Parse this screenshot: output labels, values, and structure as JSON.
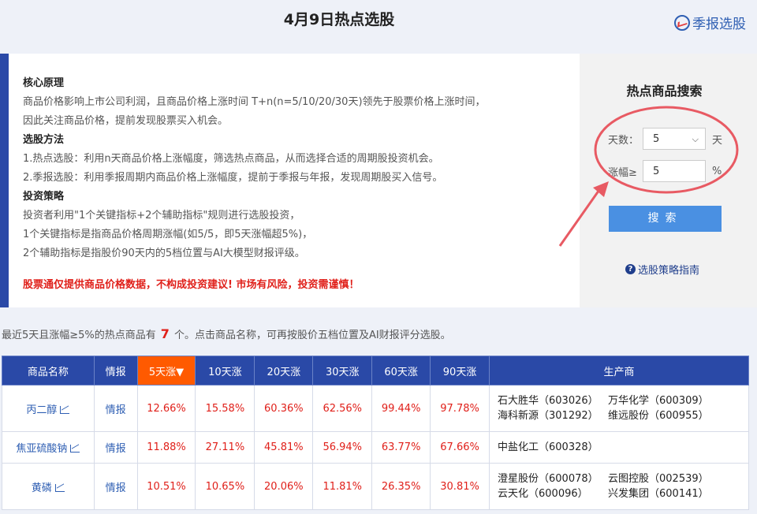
{
  "header": {
    "title": "4月9日热点选股",
    "link": "季报选股"
  },
  "intro": {
    "sections": [
      {
        "heading": "核心原理",
        "lines": [
          "商品价格影响上市公司利润，且商品价格上涨时间 T+n(n=5/10/20/30天)领先于股票价格上涨时间，",
          "因此关注商品价格，提前发现股票买入机会。"
        ]
      },
      {
        "heading": "选股方法",
        "lines": [
          "1.热点选股：利用n天商品价格上涨幅度，筛选热点商品，从而选择合适的周期股投资机会。",
          "2.季报选股：利用季报周期内商品价格上涨幅度，提前于季报与年报，发现周期股买入信号。"
        ]
      },
      {
        "heading": "投资策略",
        "lines": [
          "投资者利用\"1个关键指标+2个辅助指标\"规则进行选股投资，",
          "1个关键指标是指商品价格周期涨幅(如5/5，即5天涨幅超5%)，",
          "2个辅助指标是指股价90天内的5档位置与AI大模型财报评级。"
        ]
      }
    ],
    "warning": "股票通仅提供商品价格数据，不构成投资建议! 市场有风险，投资需谨慎！"
  },
  "search": {
    "title": "热点商品搜索",
    "days_label": "天数：",
    "days_value": "5",
    "days_unit": "天",
    "rise_label": "涨幅≥",
    "rise_value": "5",
    "rise_unit": "%",
    "button": "搜索",
    "guide": "选股策略指南",
    "annotation_color": "#e85a63"
  },
  "summary": {
    "prefix": "最近5天且涨幅≥5%的热点商品有",
    "count": "7",
    "suffix": "个。点击商品名称，可再按股价五档位置及AI财报评分选股。"
  },
  "table": {
    "headers": [
      "商品名称",
      "情报",
      "5天涨▼",
      "10天涨",
      "20天涨",
      "30天涨",
      "60天涨",
      "90天涨",
      "生产商"
    ],
    "rows": [
      {
        "name": "丙二醇",
        "info": "情报",
        "d5": "12.66%",
        "d10": "15.58%",
        "d20": "60.36%",
        "d30": "62.56%",
        "d60": "99.44%",
        "d90": "97.78%",
        "producers": [
          "石大胜华（603026）",
          "万华化学（600309）",
          "海科新源（301292）",
          "维远股份（600955）"
        ]
      },
      {
        "name": "焦亚硫酸钠",
        "info": "情报",
        "d5": "11.88%",
        "d10": "27.11%",
        "d20": "45.81%",
        "d30": "56.94%",
        "d60": "63.77%",
        "d90": "67.66%",
        "producers": [
          "中盐化工（600328）"
        ]
      },
      {
        "name": "黄磷",
        "info": "情报",
        "d5": "10.51%",
        "d10": "10.65%",
        "d20": "20.06%",
        "d30": "11.81%",
        "d60": "26.35%",
        "d90": "30.81%",
        "producers": [
          "澄星股份（600078）",
          "云图控股（002539）",
          "云天化（600096）",
          "兴发集团（600141）"
        ]
      }
    ]
  },
  "colors": {
    "header_blue": "#2a49a7",
    "sorted_orange": "#ff5a00",
    "rise_red": "#e0201a",
    "button_blue": "#4a90e2"
  }
}
